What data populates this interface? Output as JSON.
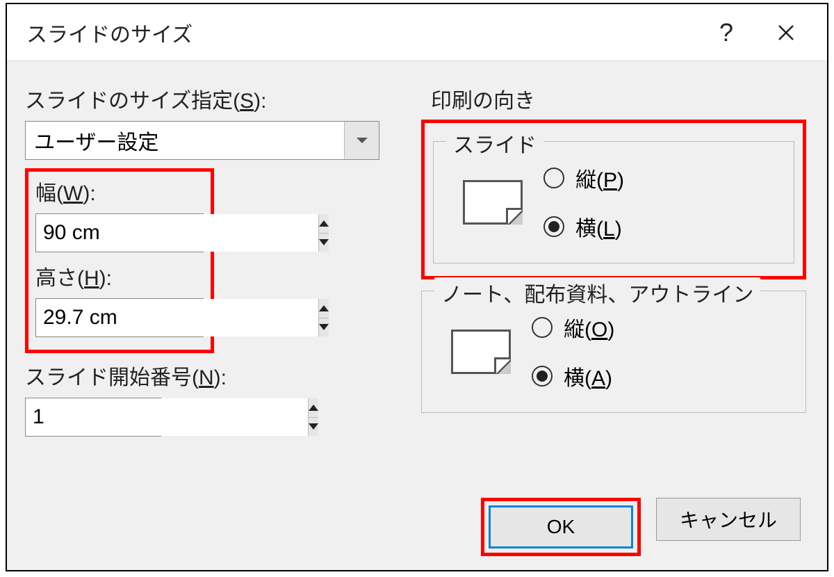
{
  "dialog": {
    "title": "スライドのサイズ",
    "help_label": "?",
    "close_label": "✕"
  },
  "left": {
    "size_label_pre": "スライドのサイズ指定(",
    "size_label_key": "S",
    "size_label_post": "):",
    "size_combo_value": "ユーザー設定",
    "width_label_pre": "幅(",
    "width_label_key": "W",
    "width_label_post": "):",
    "width_value": "90 cm",
    "height_label_pre": "高さ(",
    "height_label_key": "H",
    "height_label_post": "):",
    "height_value": "29.7 cm",
    "startnum_label_pre": "スライド開始番号(",
    "startnum_label_key": "N",
    "startnum_label_post": "):",
    "startnum_value": "1"
  },
  "right": {
    "orientation_group": "印刷の向き",
    "slides_group": "スライド",
    "slides_portrait_pre": "縦(",
    "slides_portrait_key": "P",
    "slides_portrait_post": ")",
    "slides_landscape_pre": "横(",
    "slides_landscape_key": "L",
    "slides_landscape_post": ")",
    "notes_group": "ノート、配布資料、アウトライン",
    "notes_portrait_pre": "縦(",
    "notes_portrait_key": "O",
    "notes_portrait_post": ")",
    "notes_landscape_pre": "横(",
    "notes_landscape_key": "A",
    "notes_landscape_post": ")"
  },
  "buttons": {
    "ok": "OK",
    "cancel": "キャンセル"
  },
  "annotations": {
    "highlight_color": "#ff0000",
    "highlighted": [
      "width-height-block",
      "slides-orientation-group",
      "ok-button"
    ]
  }
}
